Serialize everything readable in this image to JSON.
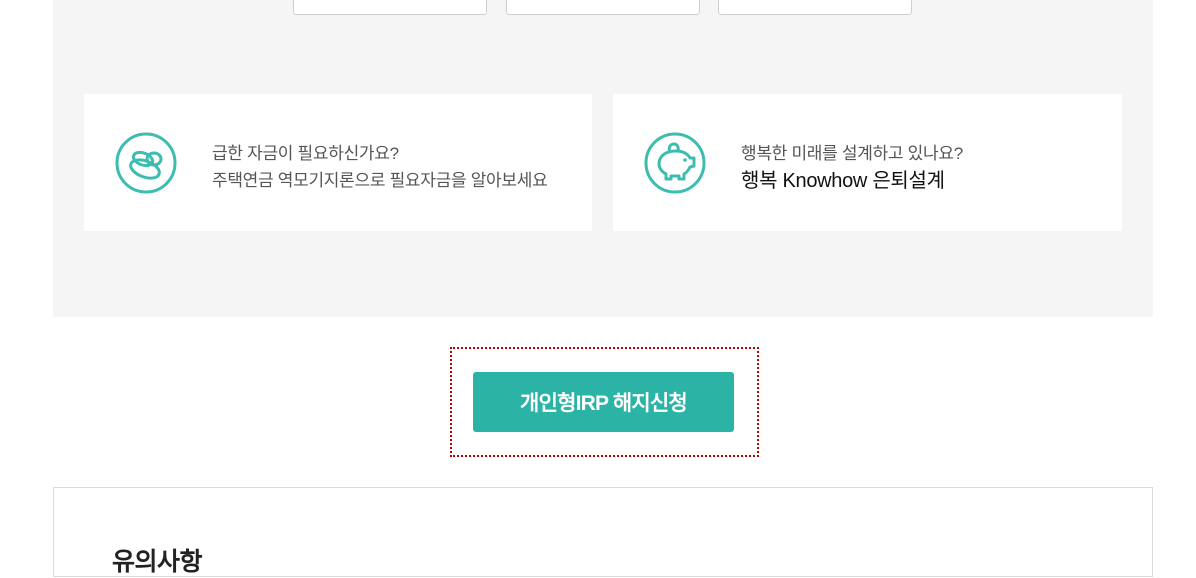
{
  "cards": [
    {
      "icon": "coins-icon",
      "line1": "급한 자금이 필요하신가요?",
      "line2": "주택연금 역모기지론으로 필요자금을 알아보세요"
    },
    {
      "icon": "piggy-bank-icon",
      "line1": "행복한 미래를 설계하고 있나요?",
      "line2": "행복 Knowhow 은퇴설계"
    }
  ],
  "main_button": {
    "label": "개인형IRP 해지신청"
  },
  "notice": {
    "title": "유의사항"
  },
  "colors": {
    "accent": "#2bb3a6",
    "panel": "#f5f5f5",
    "focus": "#c00000"
  }
}
